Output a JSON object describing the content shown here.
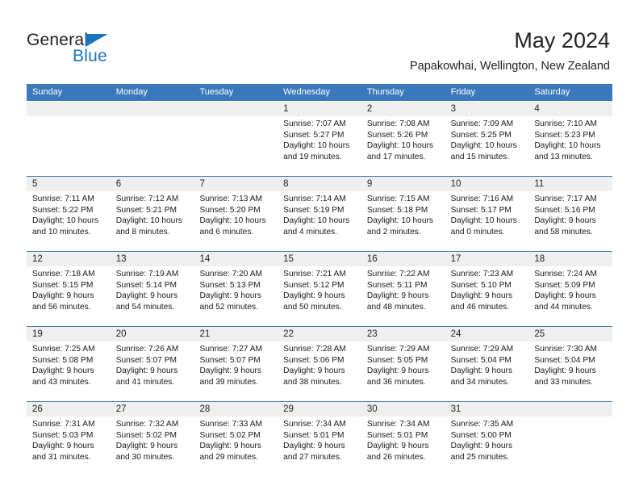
{
  "brand": {
    "name_top": "General",
    "name_bottom": "Blue",
    "triangle_icon": "blue-triangle-icon",
    "color_dark": "#231f20",
    "color_blue": "#1b75bb"
  },
  "header": {
    "title": "May 2024",
    "subtitle": "Papakowhai, Wellington, New Zealand"
  },
  "theme": {
    "header_bar": "#3a78bc",
    "date_band": "#efefef",
    "separator": "#4a7fae",
    "text": "#1a1a1a"
  },
  "weekdays": [
    "Sunday",
    "Monday",
    "Tuesday",
    "Wednesday",
    "Thursday",
    "Friday",
    "Saturday"
  ],
  "weeks": [
    {
      "days": [
        {
          "date": "",
          "sunrise": "",
          "sunset": "",
          "daylight": ""
        },
        {
          "date": "",
          "sunrise": "",
          "sunset": "",
          "daylight": ""
        },
        {
          "date": "",
          "sunrise": "",
          "sunset": "",
          "daylight": ""
        },
        {
          "date": "1",
          "sunrise": "Sunrise: 7:07 AM",
          "sunset": "Sunset: 5:27 PM",
          "daylight": "Daylight: 10 hours and 19 minutes."
        },
        {
          "date": "2",
          "sunrise": "Sunrise: 7:08 AM",
          "sunset": "Sunset: 5:26 PM",
          "daylight": "Daylight: 10 hours and 17 minutes."
        },
        {
          "date": "3",
          "sunrise": "Sunrise: 7:09 AM",
          "sunset": "Sunset: 5:25 PM",
          "daylight": "Daylight: 10 hours and 15 minutes."
        },
        {
          "date": "4",
          "sunrise": "Sunrise: 7:10 AM",
          "sunset": "Sunset: 5:23 PM",
          "daylight": "Daylight: 10 hours and 13 minutes."
        }
      ]
    },
    {
      "days": [
        {
          "date": "5",
          "sunrise": "Sunrise: 7:11 AM",
          "sunset": "Sunset: 5:22 PM",
          "daylight": "Daylight: 10 hours and 10 minutes."
        },
        {
          "date": "6",
          "sunrise": "Sunrise: 7:12 AM",
          "sunset": "Sunset: 5:21 PM",
          "daylight": "Daylight: 10 hours and 8 minutes."
        },
        {
          "date": "7",
          "sunrise": "Sunrise: 7:13 AM",
          "sunset": "Sunset: 5:20 PM",
          "daylight": "Daylight: 10 hours and 6 minutes."
        },
        {
          "date": "8",
          "sunrise": "Sunrise: 7:14 AM",
          "sunset": "Sunset: 5:19 PM",
          "daylight": "Daylight: 10 hours and 4 minutes."
        },
        {
          "date": "9",
          "sunrise": "Sunrise: 7:15 AM",
          "sunset": "Sunset: 5:18 PM",
          "daylight": "Daylight: 10 hours and 2 minutes."
        },
        {
          "date": "10",
          "sunrise": "Sunrise: 7:16 AM",
          "sunset": "Sunset: 5:17 PM",
          "daylight": "Daylight: 10 hours and 0 minutes."
        },
        {
          "date": "11",
          "sunrise": "Sunrise: 7:17 AM",
          "sunset": "Sunset: 5:16 PM",
          "daylight": "Daylight: 9 hours and 58 minutes."
        }
      ]
    },
    {
      "days": [
        {
          "date": "12",
          "sunrise": "Sunrise: 7:18 AM",
          "sunset": "Sunset: 5:15 PM",
          "daylight": "Daylight: 9 hours and 56 minutes."
        },
        {
          "date": "13",
          "sunrise": "Sunrise: 7:19 AM",
          "sunset": "Sunset: 5:14 PM",
          "daylight": "Daylight: 9 hours and 54 minutes."
        },
        {
          "date": "14",
          "sunrise": "Sunrise: 7:20 AM",
          "sunset": "Sunset: 5:13 PM",
          "daylight": "Daylight: 9 hours and 52 minutes."
        },
        {
          "date": "15",
          "sunrise": "Sunrise: 7:21 AM",
          "sunset": "Sunset: 5:12 PM",
          "daylight": "Daylight: 9 hours and 50 minutes."
        },
        {
          "date": "16",
          "sunrise": "Sunrise: 7:22 AM",
          "sunset": "Sunset: 5:11 PM",
          "daylight": "Daylight: 9 hours and 48 minutes."
        },
        {
          "date": "17",
          "sunrise": "Sunrise: 7:23 AM",
          "sunset": "Sunset: 5:10 PM",
          "daylight": "Daylight: 9 hours and 46 minutes."
        },
        {
          "date": "18",
          "sunrise": "Sunrise: 7:24 AM",
          "sunset": "Sunset: 5:09 PM",
          "daylight": "Daylight: 9 hours and 44 minutes."
        }
      ]
    },
    {
      "days": [
        {
          "date": "19",
          "sunrise": "Sunrise: 7:25 AM",
          "sunset": "Sunset: 5:08 PM",
          "daylight": "Daylight: 9 hours and 43 minutes."
        },
        {
          "date": "20",
          "sunrise": "Sunrise: 7:26 AM",
          "sunset": "Sunset: 5:07 PM",
          "daylight": "Daylight: 9 hours and 41 minutes."
        },
        {
          "date": "21",
          "sunrise": "Sunrise: 7:27 AM",
          "sunset": "Sunset: 5:07 PM",
          "daylight": "Daylight: 9 hours and 39 minutes."
        },
        {
          "date": "22",
          "sunrise": "Sunrise: 7:28 AM",
          "sunset": "Sunset: 5:06 PM",
          "daylight": "Daylight: 9 hours and 38 minutes."
        },
        {
          "date": "23",
          "sunrise": "Sunrise: 7:29 AM",
          "sunset": "Sunset: 5:05 PM",
          "daylight": "Daylight: 9 hours and 36 minutes."
        },
        {
          "date": "24",
          "sunrise": "Sunrise: 7:29 AM",
          "sunset": "Sunset: 5:04 PM",
          "daylight": "Daylight: 9 hours and 34 minutes."
        },
        {
          "date": "25",
          "sunrise": "Sunrise: 7:30 AM",
          "sunset": "Sunset: 5:04 PM",
          "daylight": "Daylight: 9 hours and 33 minutes."
        }
      ]
    },
    {
      "days": [
        {
          "date": "26",
          "sunrise": "Sunrise: 7:31 AM",
          "sunset": "Sunset: 5:03 PM",
          "daylight": "Daylight: 9 hours and 31 minutes."
        },
        {
          "date": "27",
          "sunrise": "Sunrise: 7:32 AM",
          "sunset": "Sunset: 5:02 PM",
          "daylight": "Daylight: 9 hours and 30 minutes."
        },
        {
          "date": "28",
          "sunrise": "Sunrise: 7:33 AM",
          "sunset": "Sunset: 5:02 PM",
          "daylight": "Daylight: 9 hours and 29 minutes."
        },
        {
          "date": "29",
          "sunrise": "Sunrise: 7:34 AM",
          "sunset": "Sunset: 5:01 PM",
          "daylight": "Daylight: 9 hours and 27 minutes."
        },
        {
          "date": "30",
          "sunrise": "Sunrise: 7:34 AM",
          "sunset": "Sunset: 5:01 PM",
          "daylight": "Daylight: 9 hours and 26 minutes."
        },
        {
          "date": "31",
          "sunrise": "Sunrise: 7:35 AM",
          "sunset": "Sunset: 5:00 PM",
          "daylight": "Daylight: 9 hours and 25 minutes."
        },
        {
          "date": "",
          "sunrise": "",
          "sunset": "",
          "daylight": ""
        }
      ]
    }
  ]
}
